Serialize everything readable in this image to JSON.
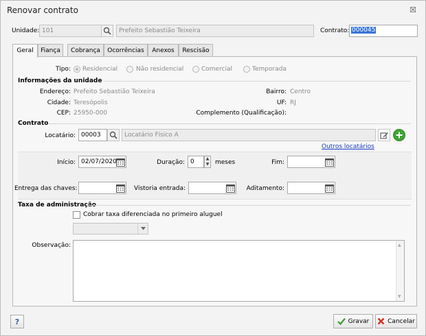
{
  "window": {
    "title": "Renovar contrato",
    "close_glyph": "☒"
  },
  "header": {
    "unidade_label": "Unidade:",
    "unidade_value": "101",
    "unidade_name": "Prefeito Sebastião Teixeira",
    "contrato_label": "Contrato:",
    "contrato_value": "000045"
  },
  "tabs": [
    {
      "label": "Geral",
      "active": true
    },
    {
      "label": "Fiança"
    },
    {
      "label": "Cobrança"
    },
    {
      "label": "Ocorrências"
    },
    {
      "label": "Anexos"
    },
    {
      "label": "Rescisão"
    }
  ],
  "tipo": {
    "label": "Tipo:",
    "options": [
      "Residencial",
      "Não residencial",
      "Comercial",
      "Temporada"
    ],
    "selected": "Residencial"
  },
  "unidade_info": {
    "section_title": "Informações da unidade",
    "endereco_label": "Endereço:",
    "endereco_value": "Prefeito Sebastião Teixeira",
    "cidade_label": "Cidade:",
    "cidade_value": "Teresópolis",
    "cep_label": "CEP:",
    "cep_value": "25950-000",
    "bairro_label": "Bairro:",
    "bairro_value": "Centro",
    "uf_label": "UF:",
    "uf_value": "RJ",
    "complemento_label": "Complemento (Qualificação):",
    "complemento_value": ""
  },
  "contrato": {
    "section_title": "Contrato",
    "locatario_label": "Locatário:",
    "locatario_code": "00003",
    "locatario_name": "Locatário Físico A",
    "outros_link": "Outros locatários",
    "inicio_label": "Início:",
    "inicio_value": "02/07/2020",
    "duracao_label": "Duração:",
    "duracao_value": "0",
    "meses_label": "meses",
    "fim_label": "Fim:",
    "fim_value": "",
    "entrega_label": "Entrega das chaves:",
    "entrega_value": "",
    "vistoria_label": "Vistoria entrada:",
    "vistoria_value": "",
    "aditamento_label": "Aditamento:",
    "aditamento_value": ""
  },
  "taxa": {
    "section_title": "Taxa de administração",
    "checkbox_label": "Cobrar taxa diferenciada no primeiro aluguel",
    "checked": false,
    "select_value": ""
  },
  "observacao": {
    "label": "Observação:",
    "value": ""
  },
  "footer": {
    "help_label": "?",
    "save_label": "Gravar",
    "cancel_label": "Cancelar"
  },
  "colors": {
    "accent": "#3875d7",
    "link": "#1a3ec1",
    "add_green": "#3fa535",
    "cancel_red": "#d0311f"
  }
}
